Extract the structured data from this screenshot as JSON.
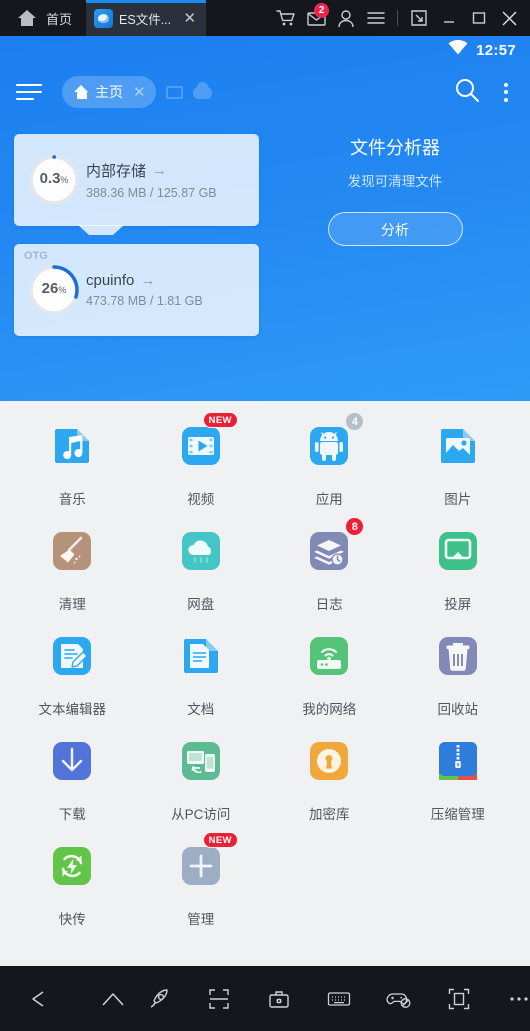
{
  "titlebar": {
    "home_label": "首页",
    "tab_title": "ES文件...",
    "tab_close": "✕",
    "mail_badge": "2",
    "icons": [
      "home-icon",
      "cart-icon",
      "mail-icon",
      "account-icon",
      "menu-icon",
      "popout-icon",
      "minimize-icon",
      "maximize-icon",
      "close-icon"
    ]
  },
  "status": {
    "time": "12:57",
    "wifi": "wifi-icon"
  },
  "nav": {
    "menu": "menu-icon",
    "breadcrumb": "主页",
    "breadcrumb_close": "✕",
    "search": "search-icon",
    "overflow": "more-vertical-icon"
  },
  "storage": [
    {
      "tag": "",
      "name": "内部存储",
      "arrow": "→",
      "size": "388.36 MB / 125.87 GB",
      "percent": "0.3",
      "percent_unit": "%",
      "percent_value": 0.3,
      "ring_color": "#1f6fd0"
    },
    {
      "tag": "OTG",
      "name": "cpuinfo",
      "arrow": "→",
      "size": "473.78 MB / 1.81 GB",
      "percent": "26",
      "percent_unit": "%",
      "percent_value": 26,
      "ring_color": "#1f6fd0"
    }
  ],
  "analyzer": {
    "title": "文件分析器",
    "subtitle": "发现可清理文件",
    "button": "分析"
  },
  "apps": [
    {
      "label": "音乐",
      "icon": "music-icon",
      "color": "#2ca8f0",
      "badge": "",
      "badge_type": ""
    },
    {
      "label": "视频",
      "icon": "video-icon",
      "color": "#2ca8f0",
      "badge": "NEW",
      "badge_type": "new"
    },
    {
      "label": "应用",
      "icon": "android-icon",
      "color": "#2ca8f0",
      "badge": "4",
      "badge_type": "grey"
    },
    {
      "label": "图片",
      "icon": "image-icon",
      "color": "#2ca8f0",
      "badge": "",
      "badge_type": ""
    },
    {
      "label": "清理",
      "icon": "broom-icon",
      "color": "#b5937a",
      "badge": "",
      "badge_type": ""
    },
    {
      "label": "网盘",
      "icon": "cloud-icon",
      "color": "#45c6c6",
      "badge": "",
      "badge_type": ""
    },
    {
      "label": "日志",
      "icon": "logs-icon",
      "color": "#8189b5",
      "badge": "8",
      "badge_type": "red"
    },
    {
      "label": "投屏",
      "icon": "cast-icon",
      "color": "#3ec08a",
      "badge": "",
      "badge_type": ""
    },
    {
      "label": "文本编辑器",
      "icon": "text-editor-icon",
      "color": "#2ca8f0",
      "badge": "",
      "badge_type": ""
    },
    {
      "label": "文档",
      "icon": "document-icon",
      "color": "#2ca8f0",
      "badge": "",
      "badge_type": ""
    },
    {
      "label": "我的网络",
      "icon": "router-icon",
      "color": "#54c479",
      "badge": "",
      "badge_type": ""
    },
    {
      "label": "回收站",
      "icon": "trash-icon",
      "color": "#8189b5",
      "badge": "",
      "badge_type": ""
    },
    {
      "label": "下载",
      "icon": "download-icon",
      "color": "#5274d8",
      "badge": "",
      "badge_type": ""
    },
    {
      "label": "从PC访问",
      "icon": "pc-access-icon",
      "color": "#5cbb93",
      "badge": "",
      "badge_type": ""
    },
    {
      "label": "加密库",
      "icon": "lock-icon",
      "color": "#f0a83c",
      "badge": "",
      "badge_type": ""
    },
    {
      "label": "压缩管理",
      "icon": "zip-icon",
      "color": "#2f7ddb",
      "badge": "",
      "badge_type": ""
    },
    {
      "label": "快传",
      "icon": "quick-transfer-icon",
      "color": "#63c44a",
      "badge": "",
      "badge_type": ""
    },
    {
      "label": "管理",
      "icon": "add-manage-icon",
      "color": "#9daec4",
      "badge": "NEW",
      "badge_type": "new"
    }
  ],
  "bottombar": {
    "icons": [
      "back-icon",
      "home-icon",
      "rocket-icon",
      "scan-icon",
      "toolbox-icon",
      "keyboard-icon",
      "gamepad-disabled-icon",
      "fullscreen-icon",
      "more-horizontal-icon"
    ]
  }
}
